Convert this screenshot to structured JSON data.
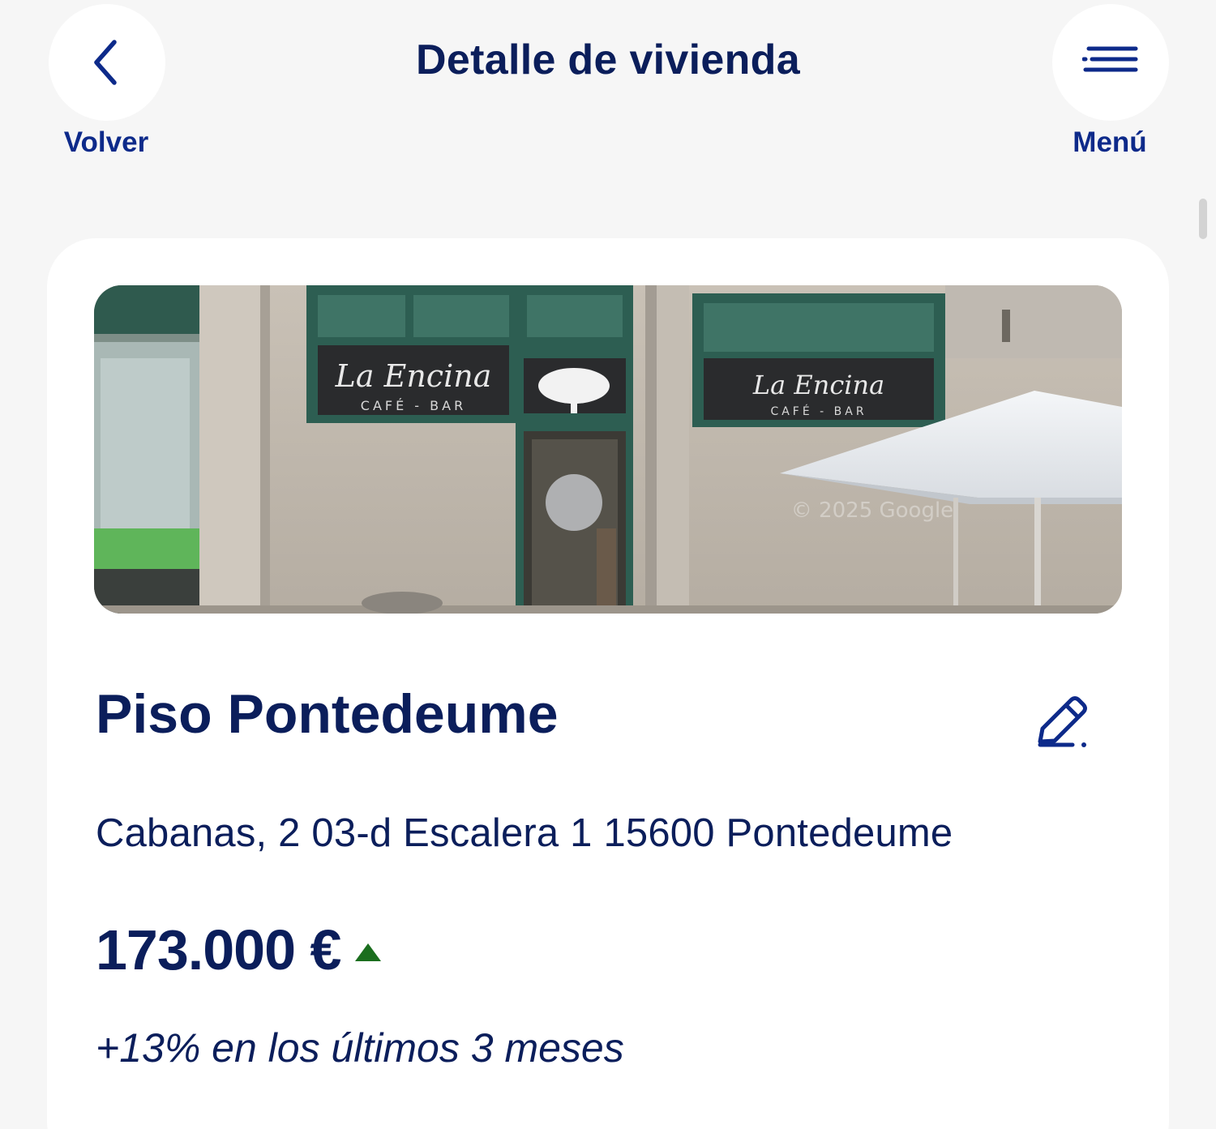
{
  "header": {
    "title": "Detalle de vivienda",
    "back_label": "Volver",
    "menu_label": "Menú",
    "back_icon": "chevron-left-icon",
    "menu_icon": "hamburger-menu-icon"
  },
  "property": {
    "name": "Piso Pontedeume",
    "address": "Cabanas, 2 03-d Escalera 1 15600 Pontedeume",
    "price": "173.000 €",
    "trend": "up",
    "change": "+13% en los últimos 3 meses",
    "edit_icon": "pencil-edit-icon",
    "photo": {
      "sign_left_title": "La Encina",
      "sign_left_sub": "CAFÉ - BAR",
      "sign_right_title": "La Encina",
      "sign_right_sub": "CAFÉ - BAR",
      "watermark": "© 2025 Google"
    }
  },
  "colors": {
    "brand_navy": "#0b1e5b",
    "link_blue": "#0d2a8a",
    "trend_green": "#1b6e1e",
    "background": "#f6f6f6",
    "card": "#ffffff"
  }
}
